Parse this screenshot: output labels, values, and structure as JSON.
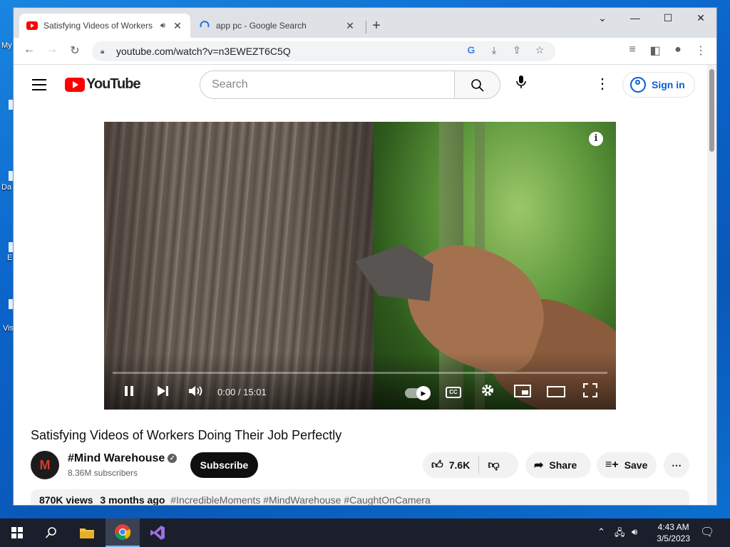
{
  "desktop": {
    "icon_labels": [
      "My",
      "Da",
      "E",
      "Vis"
    ]
  },
  "browser": {
    "tabs": [
      {
        "title": "Satisfying Videos of Workers",
        "active": true
      },
      {
        "title": "app pc - Google Search",
        "active": false
      }
    ],
    "new_tab": "+",
    "url": "youtube.com/watch?v=n3EWEZT6C5Q"
  },
  "youtube": {
    "logo_text": "YouTube",
    "search_placeholder": "Search",
    "sign_in": "Sign in",
    "player": {
      "time": "0:00 / 15:01",
      "cc_label": "CC",
      "progress": 0.0
    },
    "video_title": "Satisfying Videos of Workers Doing Their Job Perfectly",
    "channel": {
      "avatar_letter": "M",
      "name": "#Mind Warehouse",
      "subscribers": "8.36M subscribers",
      "subscribe_label": "Subscribe"
    },
    "actions": {
      "likes": "7.6K",
      "share": "Share",
      "save": "Save"
    },
    "description": {
      "views": "870K views",
      "age": "3 months ago",
      "tags": "#IncredibleMoments #MindWarehouse #CaughtOnCamera"
    }
  },
  "taskbar": {
    "time": "4:43 AM",
    "date": "3/5/2023"
  },
  "colors": {
    "youtube_red": "#ff0000",
    "link_blue": "#065fd4",
    "taskbar": "#1a1f2b"
  }
}
